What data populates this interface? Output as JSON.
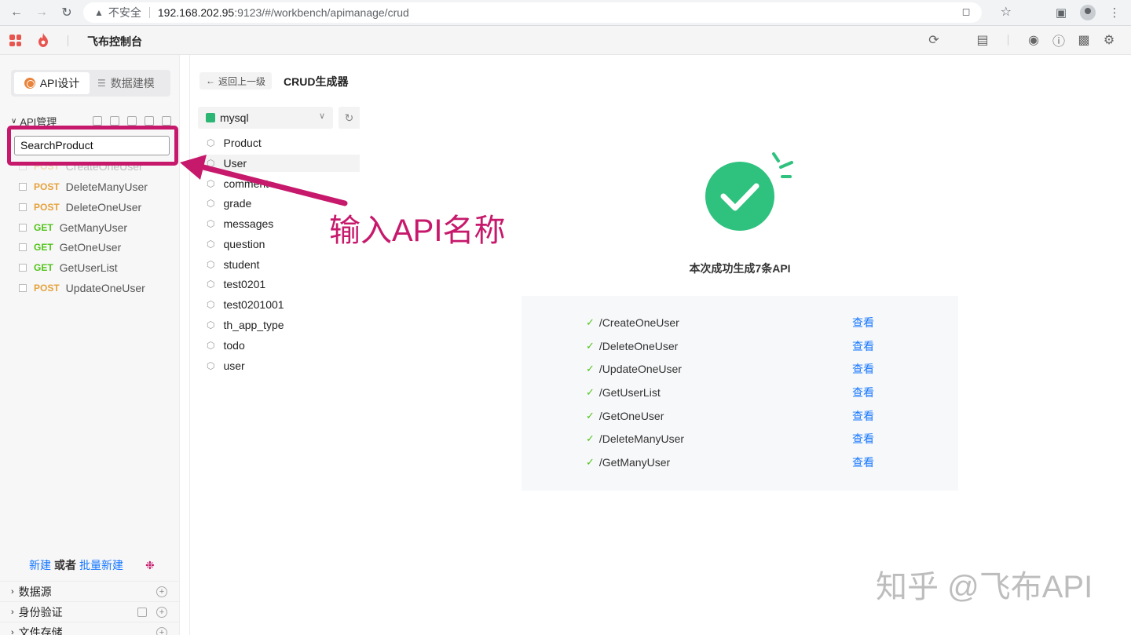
{
  "browser": {
    "insecure_label": "不安全",
    "url_host": "192.168.202.95",
    "url_path": ":9123/#/workbench/apimanage/crud"
  },
  "app": {
    "title": "飞布控制台",
    "brand_color": "#e8544e",
    "accent_color": "#c7196c"
  },
  "sidebar": {
    "tabs": [
      {
        "label": "API设计",
        "active": true
      },
      {
        "label": "数据建模",
        "active": false
      }
    ],
    "tree_title": "API管理",
    "search_value": "SearchProduct",
    "apis": [
      {
        "method": "POST",
        "name": "CreateOneUser"
      },
      {
        "method": "POST",
        "name": "DeleteManyUser"
      },
      {
        "method": "POST",
        "name": "DeleteOneUser"
      },
      {
        "method": "GET",
        "name": "GetManyUser"
      },
      {
        "method": "GET",
        "name": "GetOneUser"
      },
      {
        "method": "GET",
        "name": "GetUserList"
      },
      {
        "method": "POST",
        "name": "UpdateOneUser"
      }
    ],
    "footer": {
      "new": "新建",
      "or": "或者",
      "batch": "批量新建"
    },
    "sections": [
      "数据源",
      "身份验证",
      "文件存储"
    ]
  },
  "middle": {
    "back_label": "返回上一级",
    "title": "CRUD生成器",
    "datasource": "mysql",
    "tables": [
      "Product",
      "User",
      "comment",
      "grade",
      "messages",
      "question",
      "student",
      "test0201",
      "test0201001",
      "th_app_type",
      "todo",
      "user"
    ],
    "selected_table": "User"
  },
  "annotation": {
    "text": "输入API名称"
  },
  "result": {
    "message": "本次成功生成7条API",
    "view_label": "查看",
    "items": [
      "/CreateOneUser",
      "/DeleteOneUser",
      "/UpdateOneUser",
      "/GetUserList",
      "/GetOneUser",
      "/DeleteManyUser",
      "/GetManyUser"
    ],
    "success_color": "#2ec27e"
  },
  "watermark": "知乎 @飞布API"
}
